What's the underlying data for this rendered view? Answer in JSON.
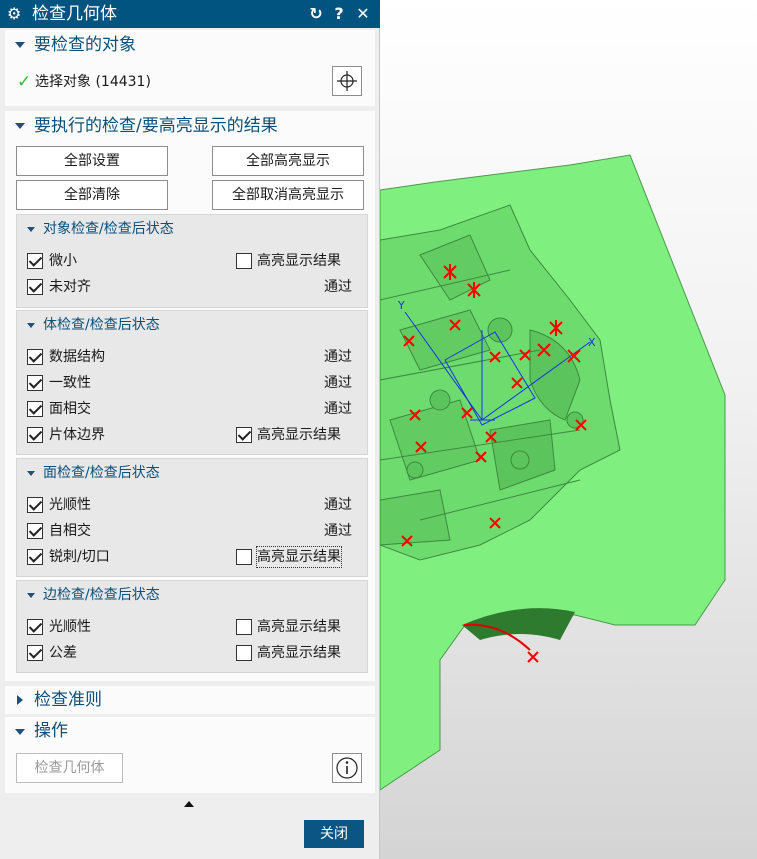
{
  "dialog": {
    "title": "检查几何体",
    "icons": {
      "settings": "gear-icon",
      "reset": "reset-icon",
      "help": "help-icon",
      "close": "close-icon"
    }
  },
  "select_section": {
    "header": "要检查的对象",
    "select_label": "选择对象 (14431)"
  },
  "checks_section": {
    "header": "要执行的检查/要高亮显示的结果",
    "buttons": {
      "set_all": "全部设置",
      "highlight_all": "全部高亮显示",
      "clear_all": "全部清除",
      "unhighlight_all": "全部取消高亮显示"
    },
    "object_checks": {
      "title": "对象检查/检查后状态",
      "rows": [
        {
          "label": "微小",
          "checked": true,
          "status": "",
          "highlight_label": "高亮显示结果",
          "highlight_checked": false
        },
        {
          "label": "未对齐",
          "checked": true,
          "status": "通过"
        }
      ]
    },
    "body_checks": {
      "title": "体检查/检查后状态",
      "rows": [
        {
          "label": "数据结构",
          "checked": true,
          "status": "通过"
        },
        {
          "label": "一致性",
          "checked": true,
          "status": "通过"
        },
        {
          "label": "面相交",
          "checked": true,
          "status": "通过"
        },
        {
          "label": "片体边界",
          "checked": true,
          "highlight_label": "高亮显示结果",
          "highlight_checked": true
        }
      ]
    },
    "face_checks": {
      "title": "面检查/检查后状态",
      "rows": [
        {
          "label": "光顺性",
          "checked": true,
          "status": "通过"
        },
        {
          "label": "自相交",
          "checked": true,
          "status": "通过"
        },
        {
          "label": "锐刺/切口",
          "checked": true,
          "highlight_label": "高亮显示结果",
          "highlight_checked": false
        }
      ]
    },
    "edge_checks": {
      "title": "边检查/检查后状态",
      "rows": [
        {
          "label": "光顺性",
          "checked": true,
          "highlight_label": "高亮显示结果",
          "highlight_checked": false
        },
        {
          "label": "公差",
          "checked": true,
          "highlight_label": "高亮显示结果",
          "highlight_checked": false
        }
      ]
    }
  },
  "criteria_section": {
    "header": "检查准则"
  },
  "operation_section": {
    "header": "操作",
    "check_button": "检查几何体",
    "info_icon": "info-icon"
  },
  "footer": {
    "close_button": "关闭"
  },
  "viewport": {
    "axis_x_label": "X",
    "axis_y_label": "Y",
    "model_color": "#7ff07f",
    "marker_color": "#ff0000"
  },
  "colors": {
    "title_bar": "#00547f",
    "header_text": "#0c4f78",
    "close_button": "#0a5583"
  }
}
